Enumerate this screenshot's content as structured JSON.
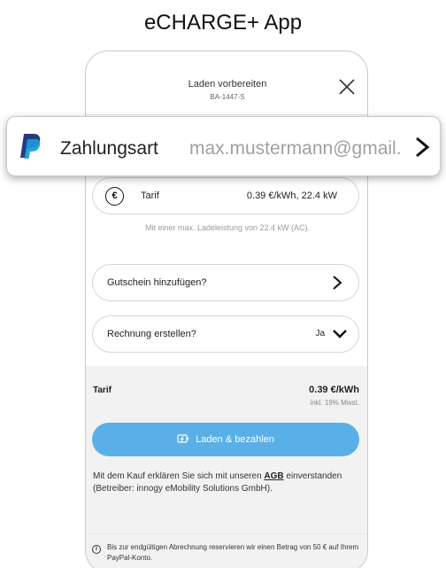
{
  "page": {
    "title": "eCHARGE+ App"
  },
  "header": {
    "title": "Laden vorbereiten",
    "station_id": "BA-1447-S"
  },
  "payment": {
    "label": "Zahlungsart",
    "account": "max.mustermann@gmail...",
    "provider_icon": "paypal-icon"
  },
  "tarif_row": {
    "label": "Tarif",
    "value": "0.39 €/kWh, 22.4 kW",
    "currency_symbol": "€"
  },
  "charging_note": "Mit einer max. Ladeleistung von 22.4 kW (AC).",
  "voucher": {
    "label": "Gutschein hinzufügen?"
  },
  "invoice": {
    "label": "Rechnung erstellen?",
    "value": "Ja"
  },
  "summary": {
    "label": "Tarif",
    "value": "0.39 €/kWh",
    "tax_note": "inkl. 19% Mwst."
  },
  "pay_button": {
    "label": "Laden & bezahlen"
  },
  "legal": {
    "prefix": "Mit dem Kauf erklären Sie sich mit unseren ",
    "link": "AGB",
    "suffix": " einverstanden (Betreiber: innogy eMobility Solutions GmbH)."
  },
  "info": {
    "icon_glyph": "i",
    "text": "Bis zur endgültigen Abrechnung reservieren wir einen Betrag von 50 € auf Ihrem PayPal-Konto."
  },
  "colors": {
    "accent": "#5ab0e6",
    "paypal_dark": "#253b80",
    "paypal_light": "#179bd7"
  }
}
